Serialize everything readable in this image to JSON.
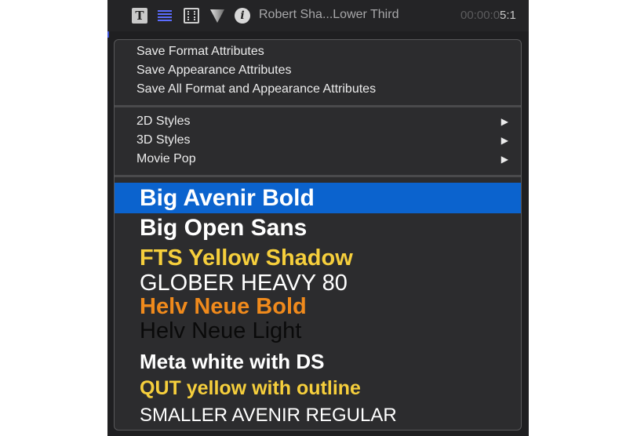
{
  "toolbar": {
    "text_icon_glyph": "T",
    "info_icon_glyph": "i",
    "clip_title": "Robert Sha...Lower Third",
    "timecode_dim": "00:00:0",
    "timecode_bright": "5:1"
  },
  "menu": {
    "save_items": [
      "Save Format Attributes",
      "Save Appearance Attributes",
      "Save All Format and Appearance Attributes"
    ],
    "submenus": [
      {
        "label": "2D Styles",
        "arrow": "▶"
      },
      {
        "label": "3D Styles",
        "arrow": "▶"
      },
      {
        "label": "Movie Pop",
        "arrow": "▶"
      }
    ],
    "styles": [
      {
        "label": "Big Avenir Bold",
        "color": "#ffffff",
        "highlighted": true
      },
      {
        "label": "Big Open Sans",
        "color": "#ffffff"
      },
      {
        "label": "FTS Yellow Shadow",
        "color": "#f6cf3c"
      },
      {
        "label": "GLOBER HEAVY 80",
        "color": "#ffffff"
      },
      {
        "label": "Helv Neue Bold",
        "color": "#f08a1c"
      },
      {
        "label": "Helv Neue Light",
        "color": "#0a0a0a"
      },
      {
        "label": "Meta white with DS",
        "color": "#ffffff"
      },
      {
        "label": "QUT yellow with outline",
        "color": "#f6cf3c"
      },
      {
        "label": "SMALLER AVENIR REGULAR",
        "color": "#ffffff"
      }
    ]
  },
  "colors": {
    "highlight": "#0b63ce",
    "menu_bg": "#2c2c2e",
    "app_bg": "#1f1f21"
  }
}
